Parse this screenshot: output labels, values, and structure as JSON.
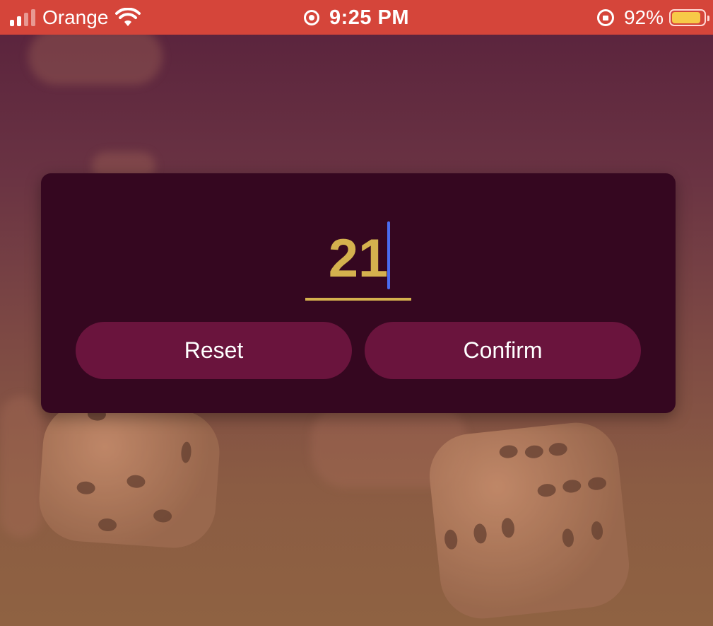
{
  "status_bar": {
    "carrier": "Orange",
    "time": "9:25 PM",
    "battery_percent": "92%",
    "battery_level": 0.92,
    "icons": [
      "signal-icon",
      "wifi-icon",
      "screen-recording-icon",
      "orientation-lock-icon",
      "battery-icon"
    ],
    "background_color": "#d5453a"
  },
  "dialog": {
    "input_value": "21",
    "value_color": "#d4b14e",
    "caret_color": "#4a6cf0",
    "reset_label": "Reset",
    "confirm_label": "Confirm",
    "background_color": "#350720",
    "button_color": "#6a143d"
  }
}
